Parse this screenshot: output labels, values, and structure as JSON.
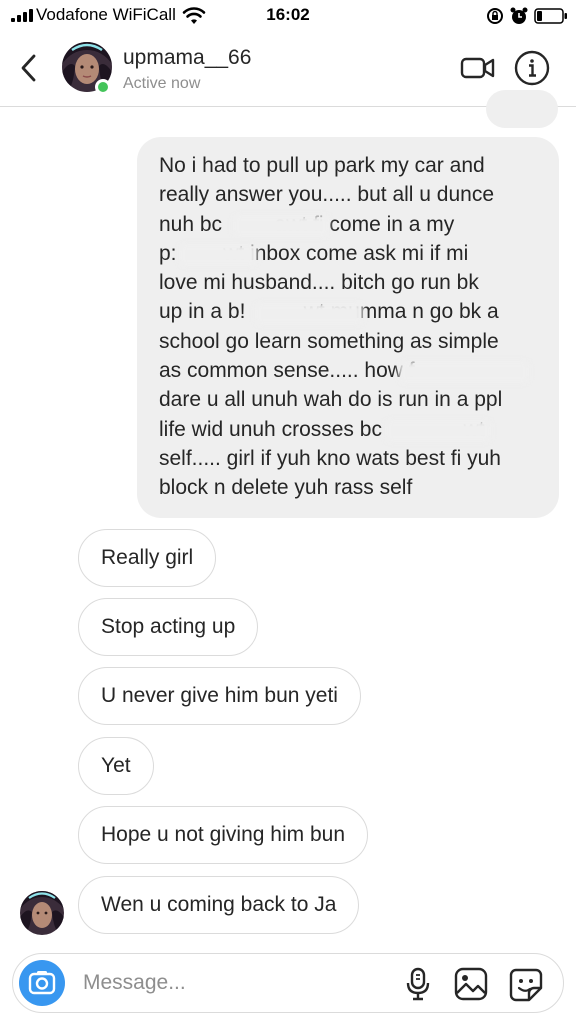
{
  "status_bar": {
    "carrier": "Vodafone WiFiCall",
    "time": "16:02",
    "icons": [
      "signal-icon",
      "wifi-icon",
      "rotation-lock-icon",
      "alarm-icon",
      "battery-icon"
    ]
  },
  "header": {
    "username": "upmama__66",
    "status": "Active now",
    "icons": [
      "back-chevron-icon",
      "video-call-icon",
      "info-icon"
    ]
  },
  "thread": {
    "sent_lines": [
      "No i had to pull up park my car and",
      "really answer you..... but all u dunce",
      "nuh bc         awt fi come in a my",
      "p:        wt inbox come ask mi if mi",
      "love mi husband.... bitch go run bk",
      "up in a b!          wt mumma n go bk a",
      "school go learn something as simple",
      "as common sense..... how f",
      "dare u all unuh wah do is run in a ppl",
      "life wid unuh crosses bc              wt",
      "self..... girl if yuh kno wats best fi yuh",
      "block n delete yuh rass self"
    ],
    "received": [
      "Really girl",
      "Stop acting up",
      "U never give him bun yeti",
      "Yet",
      "Hope u not giving him bun",
      "Wen u coming back to Ja"
    ]
  },
  "composer": {
    "placeholder": "Message...",
    "icons": [
      "camera-icon",
      "microphone-icon",
      "gallery-icon",
      "sticker-icon"
    ]
  },
  "colors": {
    "accent": "#3897f0",
    "active": "#44c45a",
    "sent_bubble": "#efefef",
    "border": "#dbdbdb",
    "muted_text": "#8e8e8e"
  }
}
